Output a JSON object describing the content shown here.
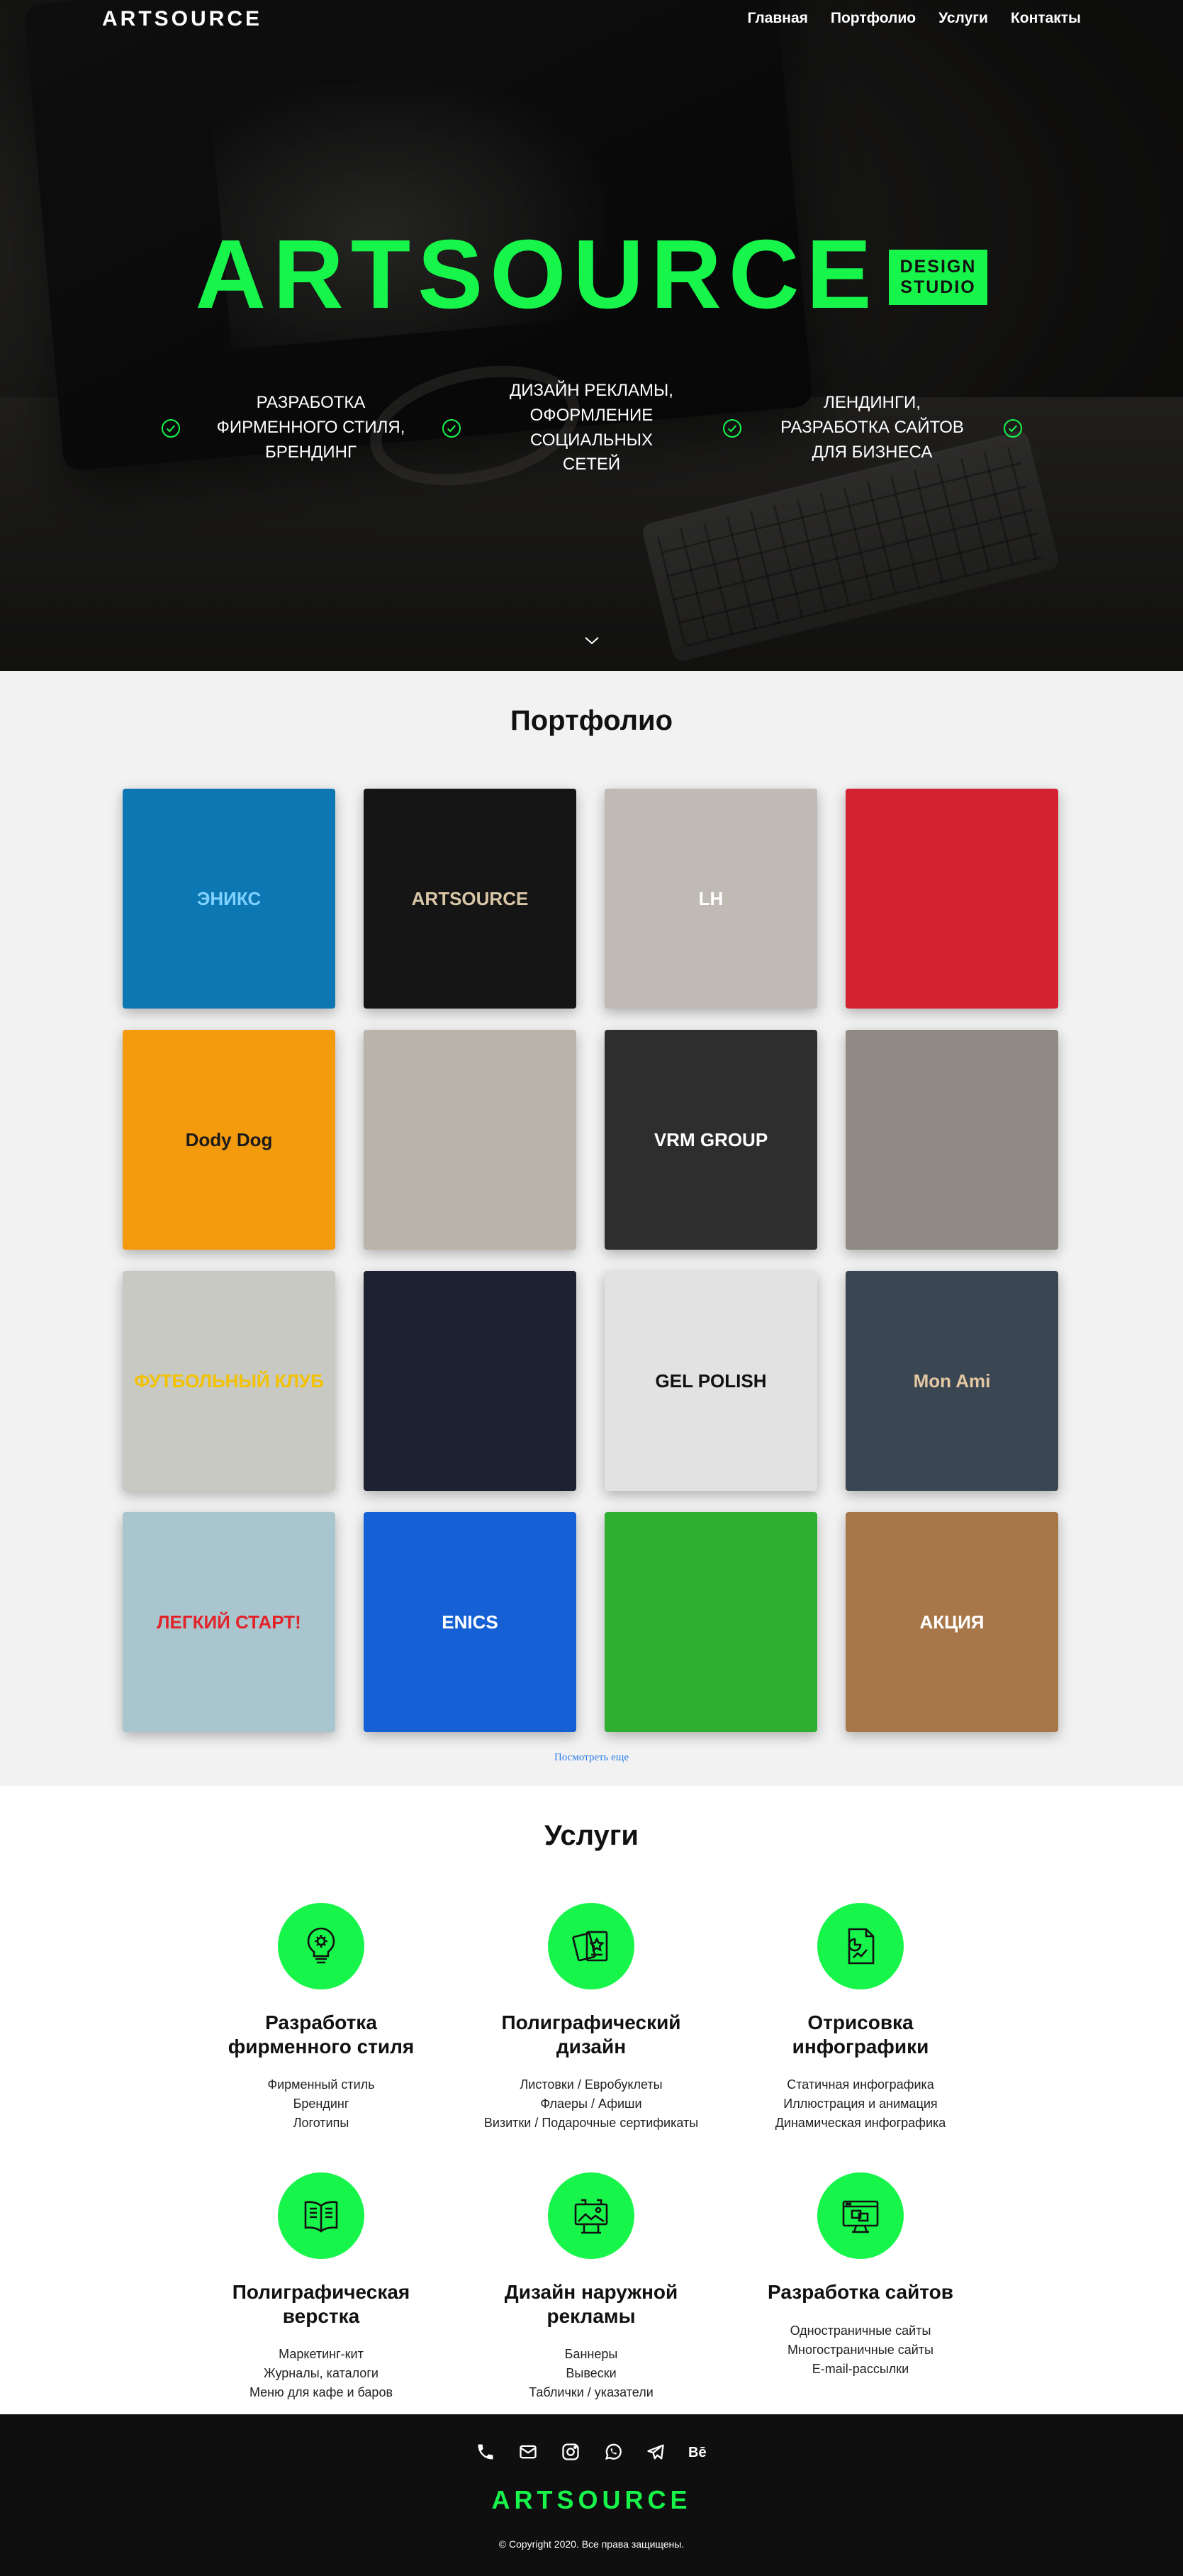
{
  "nav": {
    "brand": "ARTSOURCE",
    "items": [
      {
        "label": "Главная"
      },
      {
        "label": "Портфолио"
      },
      {
        "label": "Услуги"
      },
      {
        "label": "Контакты"
      }
    ]
  },
  "hero": {
    "title": "ARTSOURCE",
    "badge_line1": "DESIGN",
    "badge_line2": "STUDIO",
    "features": [
      {
        "line1": "РАЗРАБОТКА",
        "line2": "ФИРМЕННОГО СТИЛЯ,",
        "line3": "БРЕНДИНГ"
      },
      {
        "line1": "ДИЗАЙН РЕКЛАМЫ,",
        "line2": "ОФОРМЛЕНИЕ СОЦИАЛЬНЫХ",
        "line3": "СЕТЕЙ"
      },
      {
        "line1": "ЛЕНДИНГИ,",
        "line2": "РАЗРАБОТКА САЙТОВ",
        "line3": "ДЛЯ БИЗНЕСА"
      }
    ],
    "accent_color": "#17f54a"
  },
  "portfolio": {
    "title": "Портфолио",
    "more_link": "Посмотреть еще",
    "tiles": [
      {
        "caption": "ЭНИКС",
        "bg": "#0d77b4",
        "fg": "#7fd1ff"
      },
      {
        "caption": "ARTSOURCE",
        "bg": "#151515",
        "fg": "#d9c7a8"
      },
      {
        "caption": "LH",
        "bg": "#bfbab3",
        "fg": "#ffffff"
      },
      {
        "caption": "",
        "bg": "#d32230",
        "fg": "#ffffff"
      },
      {
        "caption": "Dody Dog",
        "bg": "#f39a0d",
        "fg": "#1a1a1a"
      },
      {
        "caption": "",
        "bg": "#b9b3a9",
        "fg": "#222222"
      },
      {
        "caption": "VRM GROUP",
        "bg": "#2e2e2e",
        "fg": "#ffffff"
      },
      {
        "caption": "",
        "bg": "#8f8a84",
        "fg": "#111111"
      },
      {
        "caption": "ФУТБОЛЬНЫЙ КЛУБ",
        "bg": "#c9c9c4",
        "fg": "#f2c200"
      },
      {
        "caption": "",
        "bg": "#1d2230",
        "fg": "#27a5d8"
      },
      {
        "caption": "GEL POLISH",
        "bg": "#e2e2e2",
        "fg": "#111111"
      },
      {
        "caption": "Mon Ami",
        "bg": "#3a4652",
        "fg": "#e4c8a3"
      },
      {
        "caption": "ЛЕГКИЙ СТАРТ!",
        "bg": "#a9c6cf",
        "fg": "#e2232a"
      },
      {
        "caption": "ENICS",
        "bg": "#1560d4",
        "fg": "#ffffff"
      },
      {
        "caption": "",
        "bg": "#2eaf2f",
        "fg": "#ffffff"
      },
      {
        "caption": "АКЦИЯ",
        "bg": "#a87749",
        "fg": "#ffffff"
      }
    ]
  },
  "services": {
    "title": "Услуги",
    "items": [
      {
        "icon": "lightbulb-gear-icon",
        "title_line1": "Разработка",
        "title_line2": "фирменного стиля",
        "lines": [
          "Фирменный стиль",
          "Брендинг",
          "Логотипы"
        ]
      },
      {
        "icon": "print-cards-icon",
        "title_line1": "Полиграфический",
        "title_line2": "дизайн",
        "lines": [
          "Листовки / Евробуклеты",
          "Флаеры / Афиши",
          "Визитки / Подарочные сертификаты"
        ]
      },
      {
        "icon": "infographic-doc-icon",
        "title_line1": "Отрисовка",
        "title_line2": "инфографики",
        "lines": [
          "Статичная инфографика",
          "Иллюстрация и анимация",
          "Динамическая инфографика"
        ]
      },
      {
        "icon": "open-book-icon",
        "title_line1": "Полиграфическая",
        "title_line2": "верстка",
        "lines": [
          "Маркетинг-кит",
          "Журналы, каталоги",
          "Меню для кафе и баров"
        ]
      },
      {
        "icon": "billboard-icon",
        "title_line1": "Дизайн наружной",
        "title_line2": "рекламы",
        "lines": [
          "Баннеры",
          "Вывески",
          "Таблички / указатели"
        ]
      },
      {
        "icon": "web-monitor-icon",
        "title_line1": "Разработка сайтов",
        "title_line2": "",
        "lines": [
          "Одностраничные сайты",
          "Многостраничные сайты",
          "E-mail-рассылки"
        ]
      }
    ]
  },
  "footer": {
    "socials": [
      "phone-icon",
      "mail-icon",
      "instagram-icon",
      "whatsapp-icon",
      "telegram-icon",
      "behance-icon"
    ],
    "brand": "ARTSOURCE",
    "copyright": "© Copyright 2020. Все права защищены."
  }
}
